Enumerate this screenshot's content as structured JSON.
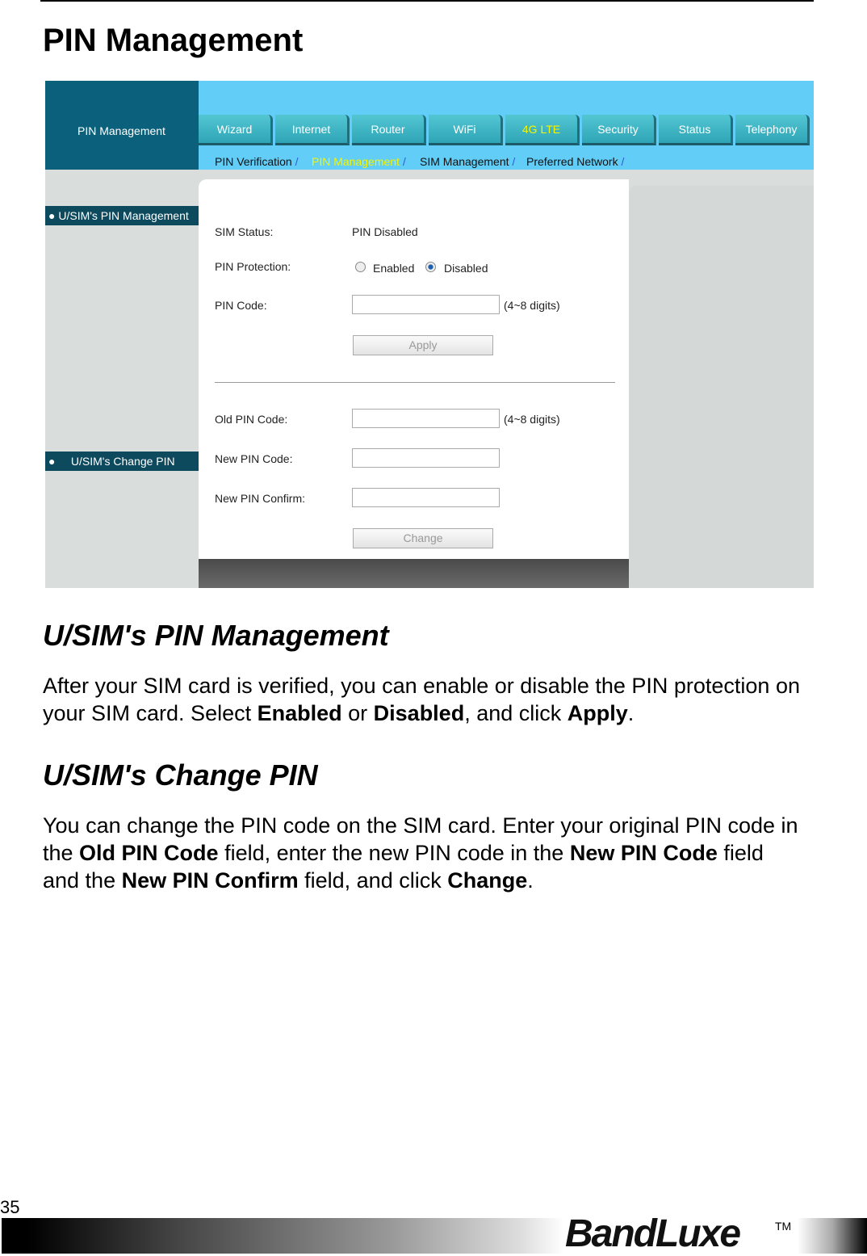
{
  "page": {
    "title": "PIN Management",
    "page_number": "35",
    "brand": "BandLuxe",
    "trademark": "TM"
  },
  "ui": {
    "header_title": "PIN Management",
    "tabs": [
      {
        "label": "Wizard"
      },
      {
        "label": "Internet"
      },
      {
        "label": "Router"
      },
      {
        "label": "WiFi"
      },
      {
        "label": "4G LTE",
        "active": true
      },
      {
        "label": "Security"
      },
      {
        "label": "Status"
      },
      {
        "label": "Telephony"
      }
    ],
    "subnav": [
      {
        "label": "PIN Verification"
      },
      {
        "label": "PIN Management",
        "active": true
      },
      {
        "label": "SIM Management"
      },
      {
        "label": "Preferred Network"
      }
    ],
    "subnav_sep": "/",
    "sidebar": [
      {
        "label": "U/SIM's PIN Management"
      },
      {
        "label": "U/SIM's Change PIN"
      }
    ],
    "form": {
      "sim_status_label": "SIM Status:",
      "sim_status_value": "PIN Disabled",
      "pin_protection_label": "PIN Protection:",
      "enabled_label": "Enabled",
      "disabled_label": "Disabled",
      "selected": "Disabled",
      "pin_code_label": "PIN Code:",
      "pin_hint": "(4~8 digits)",
      "apply_label": "Apply",
      "old_pin_label": "Old PIN Code:",
      "old_pin_hint": "(4~8 digits)",
      "new_pin_label": "New PIN Code:",
      "new_pin_confirm_label": "New PIN Confirm:",
      "change_label": "Change"
    },
    "colors": {
      "header_dark": "#0b607b",
      "header_light": "#62cdf6",
      "active_tab": "#f5f500",
      "tab": "#3fb5c5"
    }
  },
  "sections": [
    {
      "heading": "U/SIM's PIN Management",
      "text": [
        "After your SIM card is verified, you can enable or disable the PIN protection on your SIM card. Select ",
        "Enabled",
        " or ",
        "Disabled",
        ", and click ",
        "Apply",
        "."
      ]
    },
    {
      "heading": "U/SIM's Change PIN",
      "text": [
        "You can change the PIN code on the SIM card. Enter your original PIN code in the ",
        "Old PIN Code",
        " field, enter the new PIN code in the ",
        "New PIN Code",
        " field and the ",
        "New PIN Confirm",
        " field, and click ",
        "Change",
        "."
      ]
    }
  ]
}
